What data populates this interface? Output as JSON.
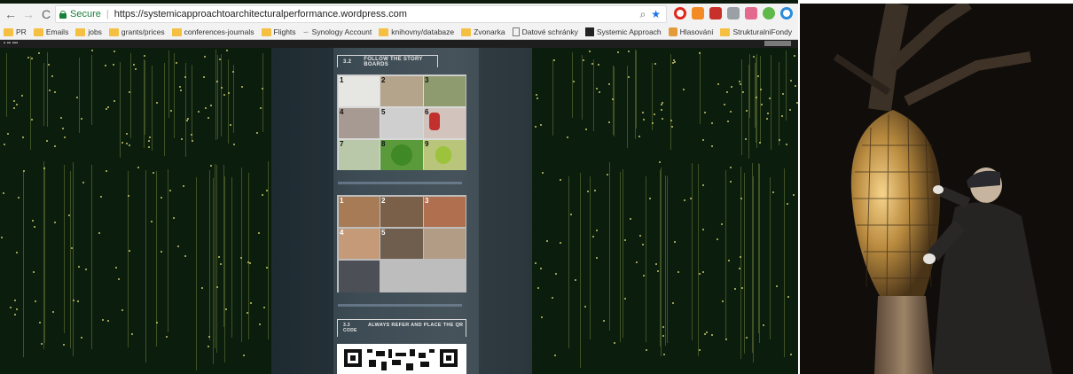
{
  "browser": {
    "back_icon": "arrow-left-icon",
    "forward_icon": "arrow-right-icon",
    "reload_icon": "reload-icon",
    "secure_label": "Secure",
    "url": "https://systemicapproachtoarchitecturalperformance.wordpress.com",
    "overflow_label": "»"
  },
  "bookmarks": [
    {
      "label": "PR"
    },
    {
      "label": "Emails"
    },
    {
      "label": "jobs"
    },
    {
      "label": "grants/prices"
    },
    {
      "label": "conferences-journals"
    },
    {
      "label": "Flights"
    },
    {
      "label": "Synology Account"
    },
    {
      "label": "knihovny/databaze"
    },
    {
      "label": "Zvonarka"
    },
    {
      "label": "Datové schránky"
    },
    {
      "label": "Systemic Approach"
    },
    {
      "label": "Hlasování"
    },
    {
      "label": "StrukturalniFondy"
    }
  ],
  "page": {
    "section1": {
      "number": "3.2",
      "title": "FOLLOW THE STORY BOARDS"
    },
    "board1_numbers": [
      "1",
      "2",
      "3",
      "4",
      "5",
      "6",
      "7",
      "8",
      "9"
    ],
    "board2_numbers": [
      "1",
      "2",
      "3",
      "4",
      "5"
    ],
    "section2": {
      "number": "3.3 CODE",
      "title": "ALWAYS REFER AND PLACE THE QR"
    }
  },
  "colors": {
    "background": "#0b1d0c",
    "strand": "#6d7d3a",
    "secure": "#188038"
  }
}
